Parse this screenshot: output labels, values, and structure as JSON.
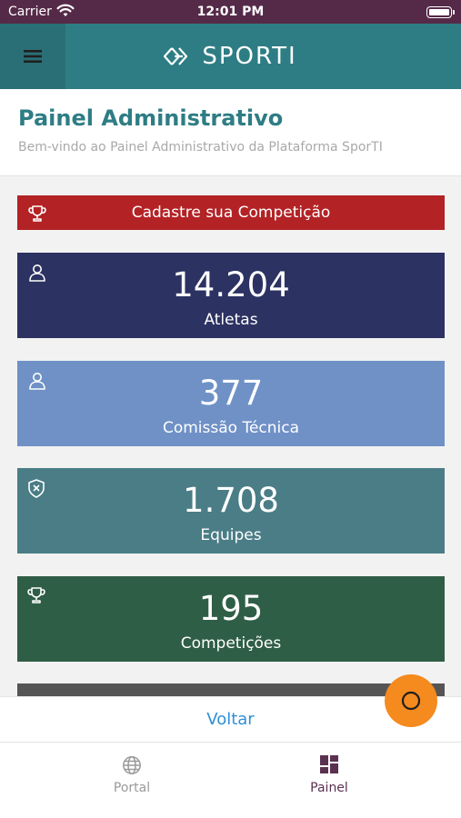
{
  "status_bar": {
    "carrier": "Carrier",
    "time": "12:01 PM"
  },
  "header": {
    "brand": "SPORTI"
  },
  "page": {
    "title": "Painel Administrativo",
    "subtitle": "Bem-vindo ao Painel Administrativo da Plataforma SporTI"
  },
  "cta": {
    "label": "Cadastre sua Competição",
    "color": "#b32225"
  },
  "cards": [
    {
      "value": "14.204",
      "label": "Atletas",
      "icon": "athlete-icon",
      "color": "#2c3262"
    },
    {
      "value": "377",
      "label": "Comissão Técnica",
      "icon": "staff-icon",
      "color": "#6f91c6"
    },
    {
      "value": "1.708",
      "label": "Equipes",
      "icon": "shield-icon",
      "color": "#4a7d86"
    },
    {
      "value": "195",
      "label": "Competições",
      "icon": "trophy-icon",
      "color": "#2f5e46"
    }
  ],
  "voltar": {
    "label": "Voltar"
  },
  "tabs": [
    {
      "label": "Portal",
      "icon": "globe-icon"
    },
    {
      "label": "Painel",
      "icon": "dashboard-icon"
    }
  ],
  "colors": {
    "status_bar": "#552a48",
    "header": "#2e7d84",
    "fab": "#f58a1f",
    "link": "#2f8fd6",
    "active_tab": "#5b3151"
  }
}
